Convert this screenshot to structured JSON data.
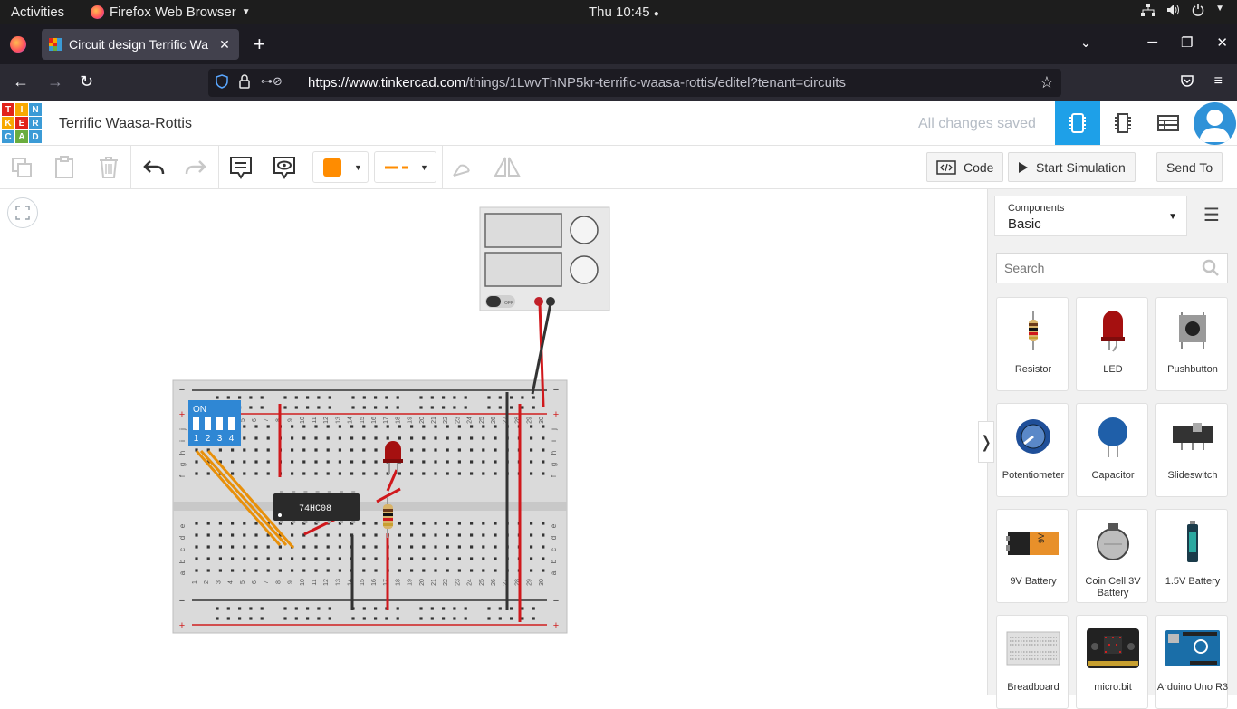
{
  "os_bar": {
    "activities": "Activities",
    "app_name": "Firefox Web Browser",
    "clock": "Thu 10:45"
  },
  "browser": {
    "tab_title": "Circuit design Terrific Wa",
    "url_host": "https://www.tinkercad.com",
    "url_path": "/things/1LwvThNP5kr-terrific-waasa-rottis/editel?tenant=circuits"
  },
  "tinkercad": {
    "logo_letters": [
      "T",
      "I",
      "N",
      "K",
      "E",
      "R",
      "C",
      "A",
      "D"
    ],
    "logo_colors": [
      "#e2231a",
      "#f7a800",
      "#3b9bd6",
      "#f7a800",
      "#e2231a",
      "#3b9bd6",
      "#3b9bd6",
      "#6aad3e",
      "#3b9bd6"
    ],
    "design_name": "Terrific Waasa-Rottis",
    "save_status": "All changes saved"
  },
  "toolbar": {
    "wire_color": "#ff8c00",
    "code_label": "Code",
    "start_sim_label": "Start Simulation",
    "send_to_label": "Send To"
  },
  "panel": {
    "components_label": "Components",
    "components_value": "Basic",
    "search_placeholder": "Search",
    "items": [
      {
        "name": "Resistor",
        "icon": "resistor-icon"
      },
      {
        "name": "LED",
        "icon": "led-icon"
      },
      {
        "name": "Pushbutton",
        "icon": "pushbutton-icon"
      },
      {
        "name": "Potentiometer",
        "icon": "potentiometer-icon"
      },
      {
        "name": "Capacitor",
        "icon": "capacitor-icon"
      },
      {
        "name": "Slideswitch",
        "icon": "slideswitch-icon"
      },
      {
        "name": "9V Battery",
        "icon": "battery-9v-icon"
      },
      {
        "name": "Coin Cell 3V Battery",
        "icon": "coin-cell-icon"
      },
      {
        "name": "1.5V Battery",
        "icon": "battery-aa-icon"
      },
      {
        "name": "Breadboard",
        "icon": "breadboard-icon"
      },
      {
        "name": "micro:bit",
        "icon": "microbit-icon"
      },
      {
        "name": "Arduino Uno R3",
        "icon": "arduino-icon"
      }
    ]
  },
  "circuit": {
    "chip_label": "74HC08",
    "dip_switch_label": "ON",
    "dip_numbers": [
      "1",
      "2",
      "3",
      "4"
    ],
    "breadboard_columns": [
      "1",
      "2",
      "3",
      "4",
      "5",
      "6",
      "7",
      "8",
      "9",
      "10",
      "11",
      "12",
      "13",
      "14",
      "15",
      "16",
      "17",
      "18",
      "19",
      "20",
      "21",
      "22",
      "23",
      "24",
      "25",
      "26",
      "27",
      "28",
      "29",
      "30"
    ],
    "row_letters_top": [
      "j",
      "i",
      "h",
      "g",
      "f"
    ],
    "row_letters_bottom": [
      "e",
      "d",
      "c",
      "b",
      "a"
    ],
    "power_supply_off_label": "OFF"
  }
}
